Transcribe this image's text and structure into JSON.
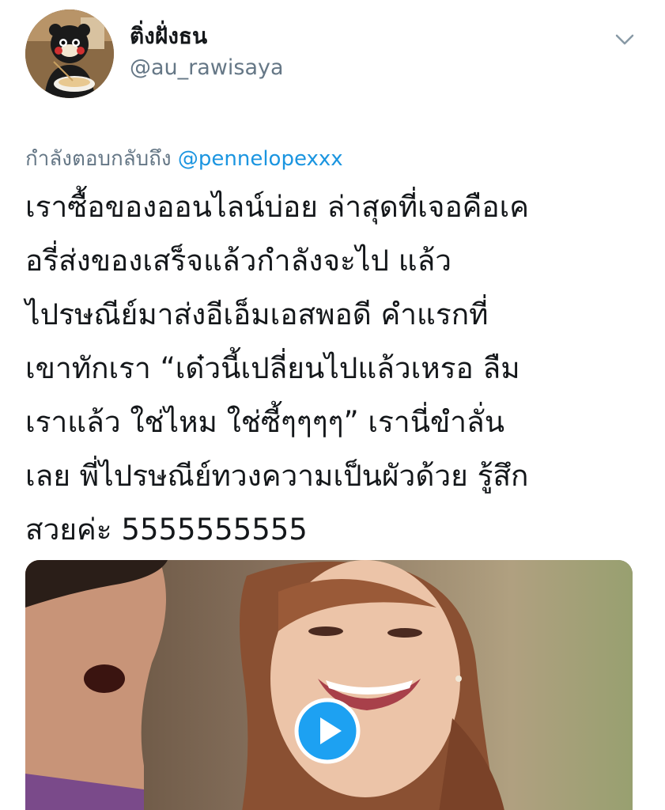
{
  "tweet": {
    "display_name": "ติ่งฝั่งธน",
    "handle": "@au_rawisaya",
    "reply_prefix": "กำลังตอบกลับถึง",
    "reply_mention": "@pennelopexxx",
    "text_lines": [
      "เราซื้อของออนไลน์บ่อย ล่าสุดที่เจอคือเค",
      "อรี่ส่งของเสร็จแล้วกำลังจะไป แล้ว",
      "ไปรษณีย์มาส่งอีเอ็มเอสพอดี คำแรกที่",
      "เขาทักเรา “เด๋วนี้เปลี่ยนไปแล้วเหรอ ลืม",
      "เราแล้ว ใช่ไหม ใช่ซี้ๆๆๆๆ” เรานี่ขำลั่น",
      "เลย พี่ไปรษณีย์ทวงความเป็นผัวด้วย รู้สึก",
      "สวยค่ะ 5555555555"
    ]
  },
  "icons": {
    "menu": "chevron-down-icon",
    "media_action": "play-icon",
    "avatar": "avatar-image"
  },
  "colors": {
    "text_primary": "#14171a",
    "text_secondary": "#657786",
    "link": "#1b95e0",
    "play_button": "#1da1f2"
  }
}
